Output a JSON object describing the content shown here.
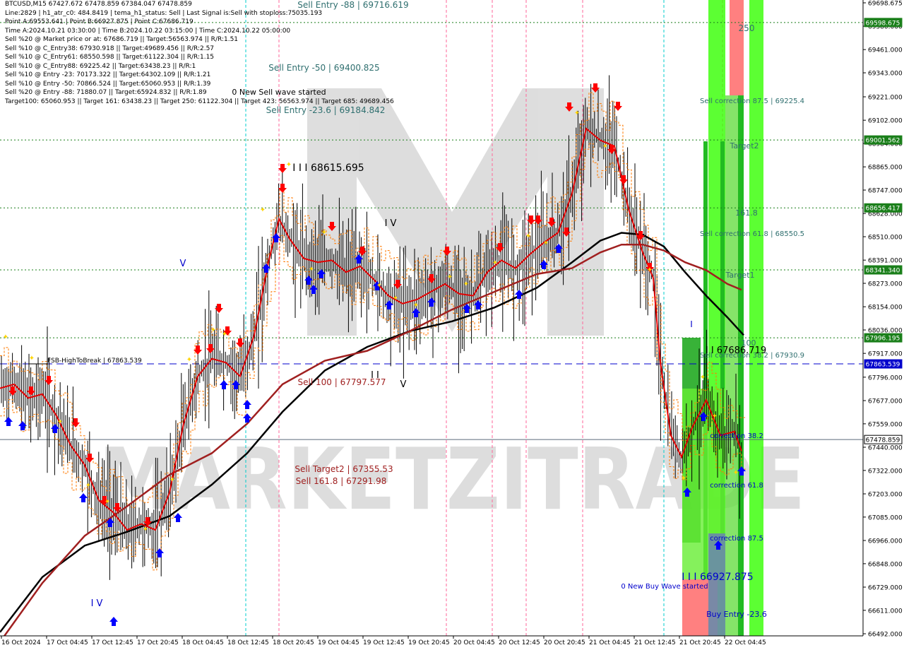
{
  "header": {
    "lines": [
      "BTCUSD,M15  67427.672 67478.859 67384.047 67478.859",
      "Line:2829  | h1_atr_c0: 484.8419  | tema_h1_status: Sell  | Last Signal is:Sell with stoploss:75035.193",
      "Point A:69553.641  | Point B:66927.875  | Point C:67686.719",
      "Time A:2024.10.21 03:30:00  | Time B:2024.10.22 03:15:00  | Time C:2024.10.22 05:00:00",
      "Sell %20 @ Market price or at: 67686.719  || Target:56563.974  || R/R:1.51",
      "Sell %10 @ C_Entry38: 67930.918  || Target:49689.456  || R/R:2.57",
      "Sell %10 @ C_Entry61: 68550.598  || Target:61122.304  || R/R:1.15",
      "Sell %10 @ C_Entry88: 69225.42  || Target:63438.23  || R/R:1",
      "Sell %10 @ Entry -23: 70173.322  || Target:64302.109  || R/R:1.21",
      "Sell %10 @ Entry -50: 70866.524  || Target:65060.953  || R/R:1.39",
      "Sell %20 @ Entry -88: 71880.07  || Target:65924.832  || R/R:1.89",
      "Target100: 65060.953  || Target 161: 63438.23  || Target 250: 61122.304  || Target 423: 56563.974  || Target 685: 49689.456"
    ]
  },
  "watermark": "MARKETZITRADE",
  "colors": {
    "grid_green": "#1a7f1a",
    "bid_line": "#5a6a7a",
    "blue_dashed": "#0000cc",
    "ma_red": "#e00000",
    "ma_brown": "#a02020",
    "ma_black": "#000000",
    "zone_green_bright": "#33ff00",
    "zone_green_mid": "#22bb22",
    "zone_green_dark": "#119911",
    "zone_salmon": "#ff8080",
    "zone_blue": "#6a8aaa",
    "sell_arrow": "#ff0000",
    "buy_arrow": "#0000ff",
    "marker_yellow": "#ffd400",
    "price_box_green": "#1a7f1a",
    "price_box_blue": "#0000cc",
    "price_box_gray": "#5a6a7a"
  },
  "chart_data": {
    "type": "line",
    "title": "BTCUSD,M15",
    "ylim": [
      66462.0,
      69698.675
    ],
    "y_axis_ticks": [
      69698.675,
      69580.0,
      69461.0,
      69343.0,
      69221.0,
      69102.0,
      68984.0,
      68865.0,
      68747.0,
      68628.0,
      68510.0,
      68391.0,
      68273.0,
      68154.0,
      68036.0,
      67917.0,
      67796.0,
      67677.0,
      67559.0,
      67440.0,
      67322.0,
      67203.0,
      67085.0,
      66966.0,
      66848.0,
      66729.0,
      66611.0,
      66492.0
    ],
    "y_axis_tick_labels": [
      "69698.675",
      "69580.000",
      "69461.000",
      "69343.000",
      "69221.000",
      "69102.000",
      "68984.000",
      "68865.000",
      "68747.000",
      "68628.000",
      "68510.000",
      "68391.000",
      "68273.000",
      "68154.000",
      "68036.000",
      "67917.000",
      "67796.000",
      "67677.000",
      "67559.000",
      "67440.000",
      "67322.000",
      "67203.000",
      "67085.000",
      "66966.000",
      "66848.000",
      "66729.000",
      "66611.000",
      "66492.000"
    ],
    "x_axis_labels": [
      "16 Oct 2024",
      "17 Oct 04:45",
      "17 Oct 12:45",
      "17 Oct 20:45",
      "18 Oct 04:45",
      "18 Oct 12:45",
      "18 Oct 20:45",
      "19 Oct 04:45",
      "19 Oct 12:45",
      "19 Oct 20:45",
      "20 Oct 04:45",
      "20 Oct 12:45",
      "20 Oct 20:45",
      "21 Oct 04:45",
      "21 Oct 12:45",
      "21 Oct 20:45",
      "22 Oct 04:45"
    ],
    "horizontal_levels": [
      {
        "value": 69598.675,
        "label": "69598.675",
        "style": "dotted",
        "color": "green"
      },
      {
        "value": 69001.562,
        "label": "69001.562",
        "style": "dotted",
        "color": "green"
      },
      {
        "value": 68656.417,
        "label": "68656.417",
        "style": "dotted",
        "color": "green"
      },
      {
        "value": 68341.34,
        "label": "68341.340",
        "style": "dotted",
        "color": "green"
      },
      {
        "value": 67996.195,
        "label": "67996.195",
        "style": "dotted",
        "color": "green"
      },
      {
        "value": 67863.539,
        "label": "67863.539",
        "style": "dashed",
        "color": "blue"
      },
      {
        "value": 67478.859,
        "label": "67478.859",
        "style": "solid",
        "color": "gray"
      }
    ],
    "annotations": [
      {
        "text": "Sell Entry -88 | 69716.619",
        "color": "#2f6f6f"
      },
      {
        "text": "Sell Entry -50 | 69400.825",
        "color": "#2f6f6f"
      },
      {
        "text": "0 New Sell wave started",
        "color": "#000000"
      },
      {
        "text": "Sell Entry -23.6 | 69184.842",
        "color": "#2f6f6f"
      },
      {
        "text": "I I I 68615.695",
        "color": "#000000"
      },
      {
        "text": "I V",
        "color": "#000000"
      },
      {
        "text": "V",
        "color": "#0000cc"
      },
      {
        "text": "FSB-HighToBreak | 67863.539",
        "color": "#000000"
      },
      {
        "text": "I I",
        "color": "#000000"
      },
      {
        "text": "V",
        "color": "#000000"
      },
      {
        "text": "Sell 100 | 67797.577",
        "color": "#a02020"
      },
      {
        "text": "Sell Target2 | 67355.53",
        "color": "#a02020"
      },
      {
        "text": "Sell 161.8 | 67291.98",
        "color": "#a02020"
      },
      {
        "text": "I V",
        "color": "#0000cc"
      },
      {
        "text": "250",
        "color": "#2f6f6f"
      },
      {
        "text": "Sell correction 87.5 | 69225.4",
        "color": "#2f6f6f"
      },
      {
        "text": "Target2",
        "color": "#2f6f6f"
      },
      {
        "text": "161.8",
        "color": "#2f6f6f"
      },
      {
        "text": "Sell correction 61.8 | 68550.5",
        "color": "#2f6f6f"
      },
      {
        "text": "Target1",
        "color": "#2f6f6f"
      },
      {
        "text": "I",
        "color": "#0000cc"
      },
      {
        "text": "100",
        "color": "#2f6f6f"
      },
      {
        "text": "I I 67686.719",
        "color": "#000000"
      },
      {
        "text": "Sell correction 38.2 | 67930.9",
        "color": "#2f6f6f"
      },
      {
        "text": "correction 38.2",
        "color": "#0000cc"
      },
      {
        "text": "correction 61.8",
        "color": "#0000cc"
      },
      {
        "text": "correction 87.5",
        "color": "#0000cc"
      },
      {
        "text": "I I I 66927.875",
        "color": "#0000cc"
      },
      {
        "text": "0 New Buy Wave started",
        "color": "#0000cc"
      },
      {
        "text": "Buy Entry -23.6",
        "color": "#0000cc"
      }
    ],
    "series": [
      {
        "color": "#000000",
        "values": [
          [
            0,
            66500
          ],
          [
            60,
            66780
          ],
          [
            120,
            66940
          ],
          [
            180,
            67010
          ],
          [
            240,
            67090
          ],
          [
            300,
            67250
          ],
          [
            350,
            67410
          ],
          [
            400,
            67620
          ],
          [
            460,
            67830
          ],
          [
            520,
            67950
          ],
          [
            580,
            68030
          ],
          [
            640,
            68080
          ],
          [
            700,
            68150
          ],
          [
            760,
            68250
          ],
          [
            810,
            68380
          ],
          [
            850,
            68490
          ],
          [
            880,
            68530
          ],
          [
            910,
            68520
          ],
          [
            940,
            68460
          ],
          [
            970,
            68330
          ],
          [
            1000,
            68210
          ],
          [
            1030,
            68100
          ],
          [
            1053,
            68010
          ]
        ]
      },
      {
        "color": "#a02020",
        "values": [
          [
            0,
            66450
          ],
          [
            60,
            66750
          ],
          [
            120,
            66990
          ],
          [
            180,
            67140
          ],
          [
            240,
            67300
          ],
          [
            300,
            67410
          ],
          [
            350,
            67560
          ],
          [
            400,
            67760
          ],
          [
            460,
            67880
          ],
          [
            520,
            67930
          ],
          [
            580,
            68030
          ],
          [
            640,
            68140
          ],
          [
            700,
            68230
          ],
          [
            760,
            68320
          ],
          [
            810,
            68350
          ],
          [
            850,
            68430
          ],
          [
            880,
            68470
          ],
          [
            910,
            68470
          ],
          [
            940,
            68440
          ],
          [
            970,
            68380
          ],
          [
            1000,
            68340
          ],
          [
            1030,
            68270
          ],
          [
            1050,
            68240
          ]
        ]
      },
      {
        "color": "#e00000",
        "values": [
          [
            0,
            67740
          ],
          [
            20,
            67760
          ],
          [
            40,
            67690
          ],
          [
            60,
            67710
          ],
          [
            80,
            67600
          ],
          [
            100,
            67450
          ],
          [
            120,
            67350
          ],
          [
            140,
            67170
          ],
          [
            160,
            67110
          ],
          [
            180,
            67020
          ],
          [
            200,
            67050
          ],
          [
            220,
            67020
          ],
          [
            240,
            67210
          ],
          [
            260,
            67560
          ],
          [
            280,
            67800
          ],
          [
            300,
            67890
          ],
          [
            320,
            67870
          ],
          [
            340,
            67800
          ],
          [
            360,
            68010
          ],
          [
            380,
            68380
          ],
          [
            395,
            68600
          ],
          [
            410,
            68500
          ],
          [
            430,
            68400
          ],
          [
            450,
            68380
          ],
          [
            470,
            68390
          ],
          [
            490,
            68330
          ],
          [
            510,
            68360
          ],
          [
            530,
            68290
          ],
          [
            550,
            68210
          ],
          [
            570,
            68170
          ],
          [
            590,
            68190
          ],
          [
            610,
            68230
          ],
          [
            630,
            68270
          ],
          [
            650,
            68220
          ],
          [
            670,
            68210
          ],
          [
            690,
            68330
          ],
          [
            710,
            68390
          ],
          [
            730,
            68350
          ],
          [
            750,
            68420
          ],
          [
            770,
            68480
          ],
          [
            790,
            68530
          ],
          [
            810,
            68730
          ],
          [
            830,
            69060
          ],
          [
            850,
            69000
          ],
          [
            870,
            68970
          ],
          [
            890,
            68650
          ],
          [
            910,
            68430
          ],
          [
            925,
            68300
          ],
          [
            935,
            67870
          ],
          [
            950,
            67500
          ],
          [
            965,
            67390
          ],
          [
            980,
            67540
          ],
          [
            1000,
            67680
          ],
          [
            1020,
            67500
          ],
          [
            1040,
            67520
          ],
          [
            1050,
            67420
          ]
        ]
      }
    ]
  }
}
